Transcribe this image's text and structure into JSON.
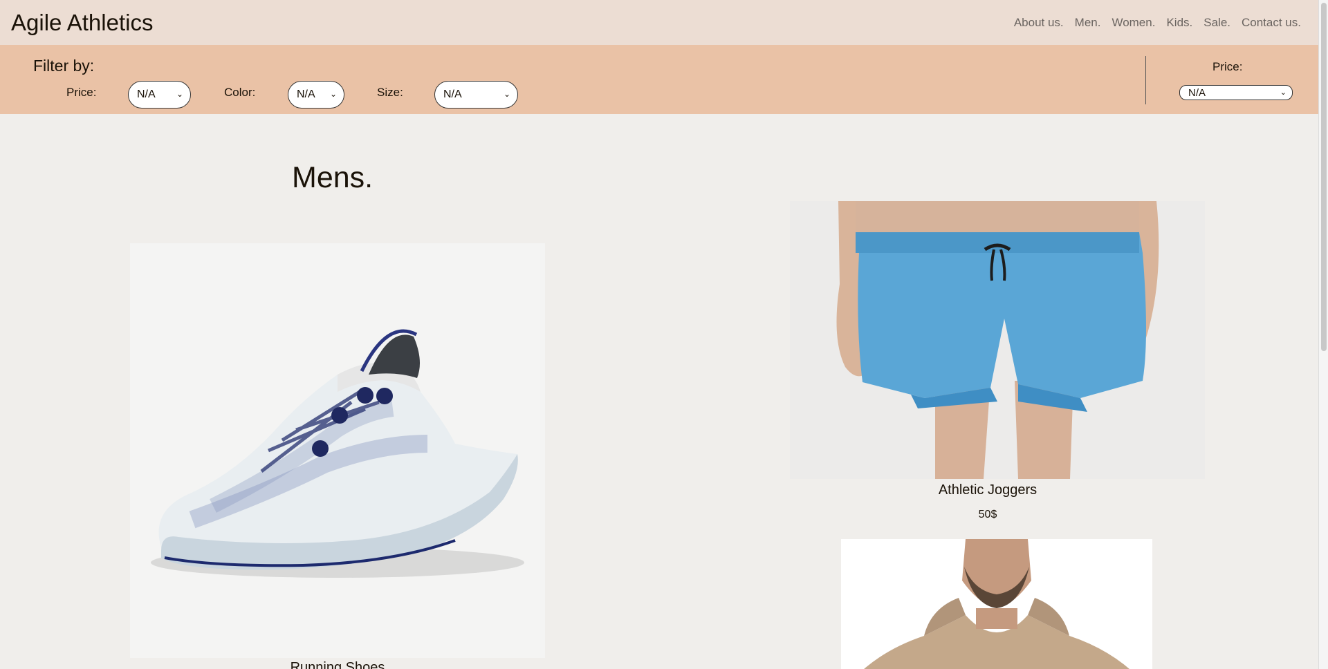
{
  "header": {
    "brand": "Agile Athletics",
    "nav": [
      "About us.",
      "Men.",
      "Women.",
      "Kids.",
      "Sale.",
      "Contact us."
    ]
  },
  "filters": {
    "title": "Filter by:",
    "price_label": "Price:",
    "price_value": "N/A",
    "color_label": "Color:",
    "color_value": "N/A",
    "size_label": "Size:",
    "size_value": "N/A",
    "sort_label": "Price:",
    "sort_value": "N/A"
  },
  "main": {
    "heading": "Mens.",
    "products": [
      {
        "name": "Running Shoes",
        "price": ""
      },
      {
        "name": "Athletic Joggers",
        "price": "50$"
      },
      {
        "name": "",
        "price": ""
      }
    ]
  },
  "colors": {
    "header_bg": "#ecddd3",
    "filter_bg": "#eac2a6",
    "page_bg": "#f0eeeb",
    "shorts_blue": "#5aa6d6"
  }
}
